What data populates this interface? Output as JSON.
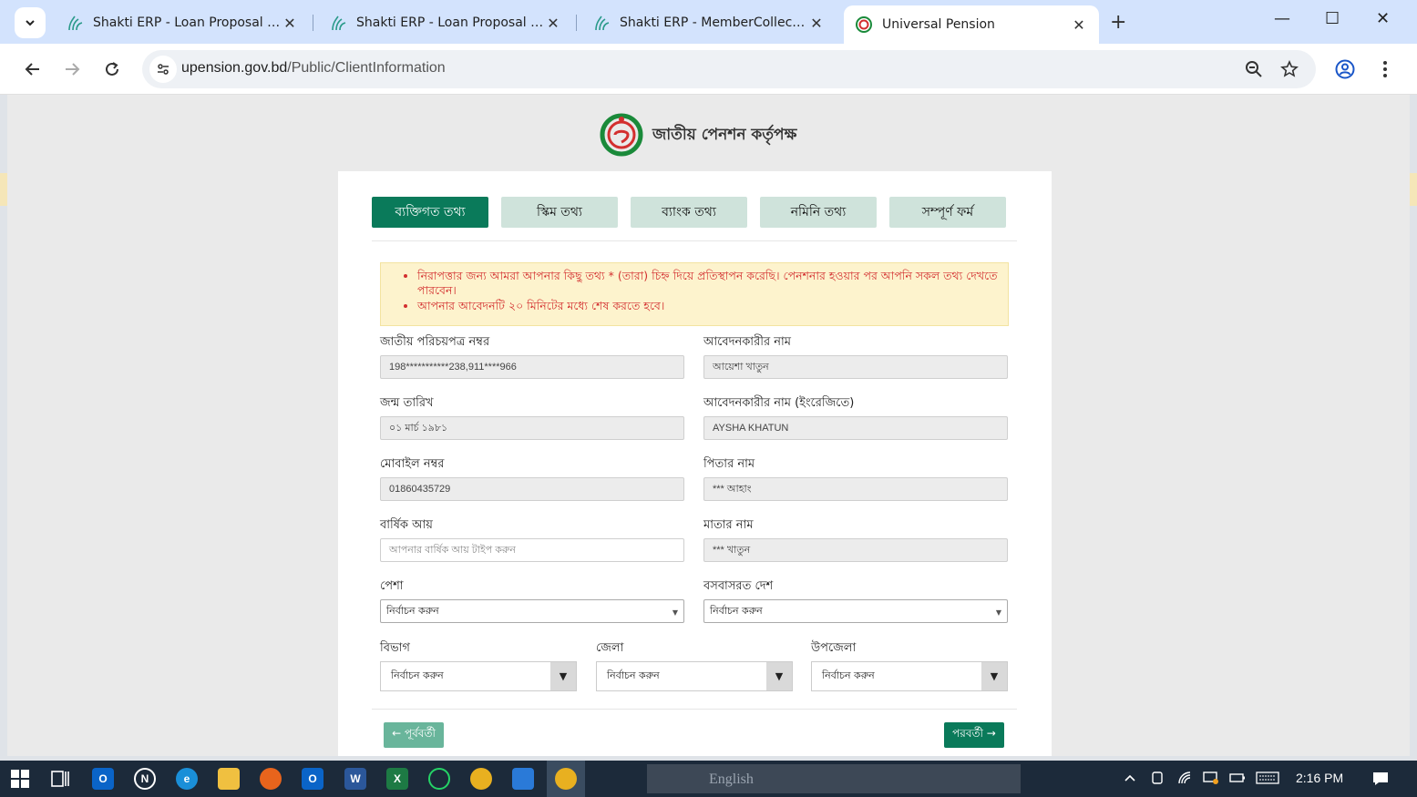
{
  "browser": {
    "tabs": [
      {
        "title": "Shakti ERP - Loan Proposal List",
        "active": false
      },
      {
        "title": "Shakti ERP - Loan Proposal Details",
        "active": false
      },
      {
        "title": "Shakti ERP - MemberCollection",
        "active": false
      },
      {
        "title": "Universal Pension",
        "active": true
      }
    ],
    "url_domain": "upension.gov.bd",
    "url_path": "/Public/ClientInformation",
    "new_tab_label": "+",
    "minimize_label": "—",
    "maximize_label": "☐",
    "close_label": "✕"
  },
  "header": {
    "org_name": "জাতীয় পেনশন কর্তৃপক্ষ"
  },
  "steps": [
    {
      "label": "ব্যক্তিগত তথ্য",
      "active": true
    },
    {
      "label": "স্কিম তথ্য",
      "active": false
    },
    {
      "label": "ব্যাংক তথ্য",
      "active": false
    },
    {
      "label": "নমিনি তথ্য",
      "active": false
    },
    {
      "label": "সম্পূর্ণ ফর্ম",
      "active": false
    }
  ],
  "alert": {
    "items": [
      "নিরাপত্তার জন্য আমরা আপনার কিছু তথ্য * (তারা) চিহ্ন দিয়ে প্রতিস্থাপন করেছি। পেনশনার হওয়ার পর আপনি সকল তথ্য দেখতে পারবেন।",
      "আপনার আবেদনটি ২০ মিনিটের মধ্যে শেষ করতে হবে।"
    ]
  },
  "form": {
    "nid": {
      "label": "জাতীয় পরিচয়পত্র নম্বর",
      "value": "198***********238,911****966"
    },
    "applicant_name": {
      "label": "আবেদনকারীর নাম",
      "value": "আয়েশা খাতুন"
    },
    "dob": {
      "label": "জন্ম তারিখ",
      "value": "০১ মার্চ ১৯৮১"
    },
    "applicant_name_en": {
      "label": "আবেদনকারীর নাম (ইংরেজিতে)",
      "value": "AYSHA KHATUN"
    },
    "mobile": {
      "label": "মোবাইল নম্বর",
      "value": "01860435729"
    },
    "father_name": {
      "label": "পিতার নাম",
      "value": "*** আহাং"
    },
    "annual_income": {
      "label": "বার্ষিক আয়",
      "placeholder": "আপনার বার্ষিক আয় টাইপ করুন"
    },
    "mother_name": {
      "label": "মাতার নাম",
      "value": "*** খাতুন"
    },
    "occupation": {
      "label": "পেশা",
      "selected": "নির্বাচন করুন"
    },
    "country": {
      "label": "বসবাসরত দেশ",
      "selected": "নির্বাচন করুন"
    },
    "division": {
      "label": "বিভাগ",
      "selected": "নির্বাচন করুন"
    },
    "district": {
      "label": "জেলা",
      "selected": "নির্বাচন করুন"
    },
    "upazila": {
      "label": "উপজেলা",
      "selected": "নির্বাচন করুন"
    }
  },
  "buttons": {
    "prev": "← পূর্ববর্তী",
    "next": "পরবর্তী →"
  },
  "taskbar": {
    "language": "English",
    "time": "2:16 PM"
  },
  "colors": {
    "primary": "#0a7a5a",
    "step_inactive": "#cfe3db",
    "alert_bg": "#fdf3cd",
    "alert_text": "#d32f2f"
  }
}
